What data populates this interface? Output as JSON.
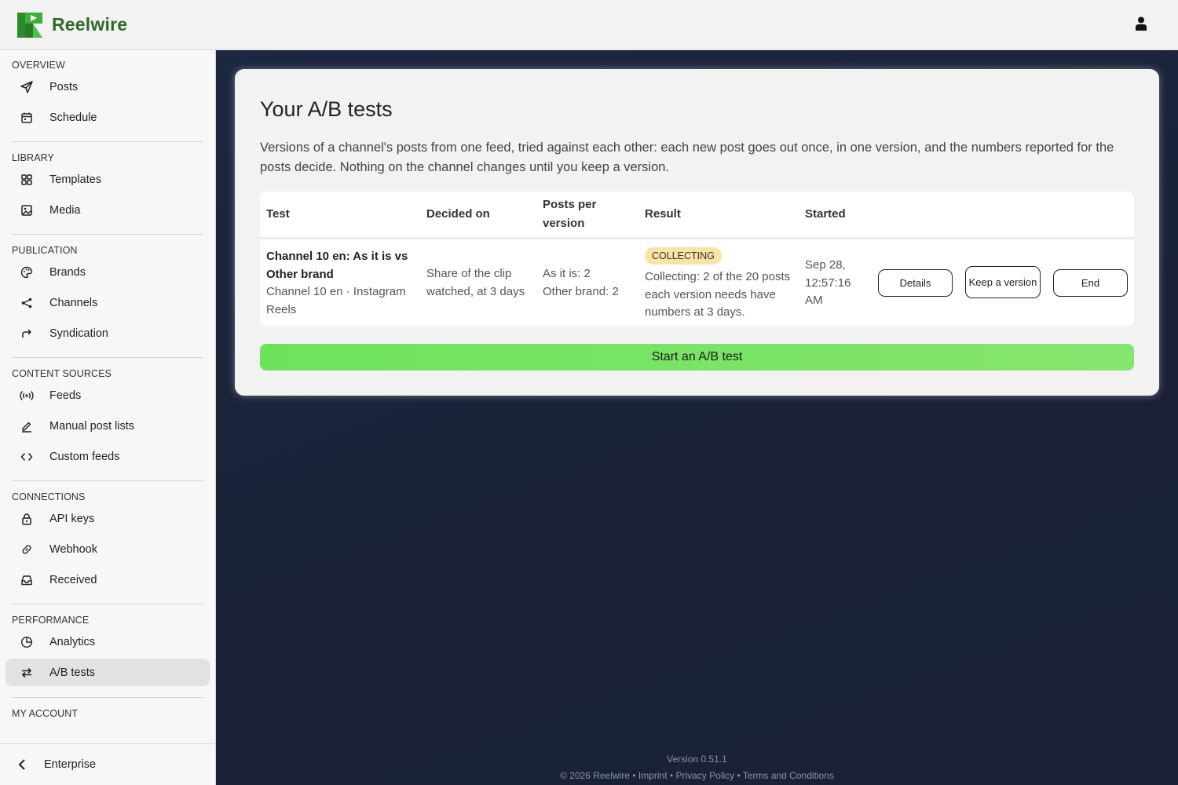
{
  "app": {
    "name": "Reelwire"
  },
  "sidebar": {
    "sections": [
      {
        "title": "OVERVIEW",
        "items": [
          {
            "label": "Posts",
            "icon": "send-icon"
          },
          {
            "label": "Schedule",
            "icon": "calendar-icon"
          }
        ]
      },
      {
        "title": "LIBRARY",
        "items": [
          {
            "label": "Templates",
            "icon": "grid-icon"
          },
          {
            "label": "Media",
            "icon": "image-icon"
          }
        ]
      },
      {
        "title": "PUBLICATION",
        "items": [
          {
            "label": "Brands",
            "icon": "palette-icon"
          },
          {
            "label": "Channels",
            "icon": "share-icon"
          },
          {
            "label": "Syndication",
            "icon": "forward-icon"
          }
        ]
      },
      {
        "title": "CONTENT SOURCES",
        "items": [
          {
            "label": "Feeds",
            "icon": "broadcast-icon"
          },
          {
            "label": "Manual post lists",
            "icon": "pencil-icon"
          },
          {
            "label": "Custom feeds",
            "icon": "code-icon"
          }
        ]
      },
      {
        "title": "CONNECTIONS",
        "items": [
          {
            "label": "API keys",
            "icon": "lock-icon"
          },
          {
            "label": "Webhook",
            "icon": "link-icon"
          },
          {
            "label": "Received",
            "icon": "inbox-icon"
          }
        ]
      },
      {
        "title": "PERFORMANCE",
        "items": [
          {
            "label": "Analytics",
            "icon": "pie-chart-icon"
          },
          {
            "label": "A/B tests",
            "icon": "swap-icon",
            "active": true
          }
        ]
      },
      {
        "title": "MY ACCOUNT",
        "items": []
      }
    ],
    "footer_label": "Enterprise"
  },
  "page": {
    "title": "Your A/B tests",
    "description": "Versions of a channel's posts from one feed, tried against each other: each new post goes out once, in one version, and the numbers reported for the posts decide. Nothing on the channel changes until you keep a version.",
    "table": {
      "headers": {
        "test": "Test",
        "decided_on": "Decided on",
        "posts_per_version": "Posts per version",
        "result": "Result",
        "started": "Started"
      },
      "rows": [
        {
          "test_name": "Channel 10 en: As it is vs Other brand",
          "test_sub": "Channel 10 en · Instagram Reels",
          "decided_on": "Share of the clip watched, at 3 days",
          "posts_a": "As it is: 2",
          "posts_b": "Other brand: 2",
          "status": "COLLECTING",
          "result_text": "Collecting: 2 of the 20 posts each version needs have numbers at 3 days.",
          "started": "Sep 28, 12:57:16 AM",
          "actions": {
            "details": "Details",
            "keep": "Keep a version",
            "end": "End"
          }
        }
      ]
    },
    "start_button": "Start an A/B test"
  },
  "footer": {
    "version": "Version 0.51.1",
    "copyright": "© 2026 Reelwire",
    "sep": "•",
    "links": {
      "imprint": "Imprint",
      "privacy": "Privacy Policy",
      "terms": "Terms and Conditions"
    }
  },
  "colors": {
    "brand_green": "#2d6a26",
    "accent_button": "#6de35a",
    "badge_bg": "#fbe3a6",
    "main_bg": "#1a2238"
  }
}
